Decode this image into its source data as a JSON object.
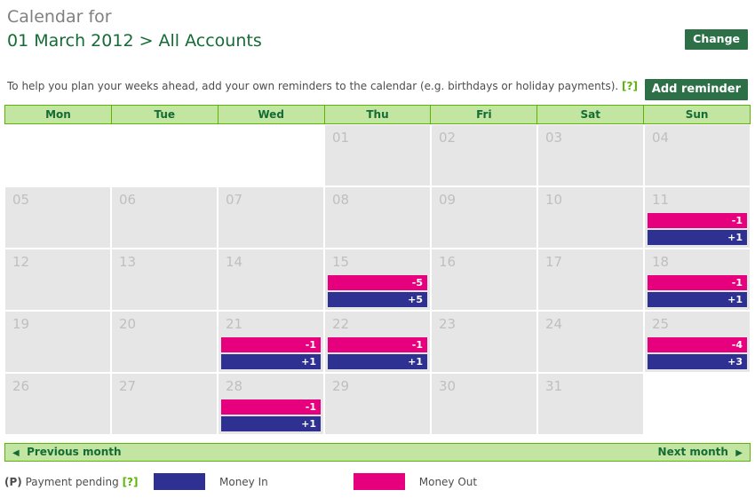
{
  "header": {
    "title_kicker": "Calendar for",
    "title_main": "01 March 2012 > All Accounts",
    "change_button": "Change",
    "add_reminder_button": "Add reminder",
    "intro_text": "To help you plan your weeks ahead, add your own reminders to the calendar (e.g. birthdays or holiday payments).",
    "intro_help": "[?]"
  },
  "calendar": {
    "day_headers": [
      "Mon",
      "Tue",
      "Wed",
      "Thu",
      "Fri",
      "Sat",
      "Sun"
    ],
    "weeks": [
      [
        {
          "day": "",
          "empty": true
        },
        {
          "day": "",
          "empty": true
        },
        {
          "day": "",
          "empty": true
        },
        {
          "day": "01"
        },
        {
          "day": "02"
        },
        {
          "day": "03"
        },
        {
          "day": "04"
        }
      ],
      [
        {
          "day": "05"
        },
        {
          "day": "06"
        },
        {
          "day": "07"
        },
        {
          "day": "08"
        },
        {
          "day": "09"
        },
        {
          "day": "10"
        },
        {
          "day": "11",
          "money_out": "-1",
          "money_in": "+1"
        }
      ],
      [
        {
          "day": "12"
        },
        {
          "day": "13"
        },
        {
          "day": "14"
        },
        {
          "day": "15",
          "money_out": "-5",
          "money_in": "+5"
        },
        {
          "day": "16"
        },
        {
          "day": "17"
        },
        {
          "day": "18",
          "money_out": "-1",
          "money_in": "+1"
        }
      ],
      [
        {
          "day": "19"
        },
        {
          "day": "20"
        },
        {
          "day": "21",
          "money_out": "-1",
          "money_in": "+1"
        },
        {
          "day": "22",
          "money_out": "-1",
          "money_in": "+1"
        },
        {
          "day": "23"
        },
        {
          "day": "24"
        },
        {
          "day": "25",
          "money_out": "-4",
          "money_in": "+3"
        }
      ],
      [
        {
          "day": "26"
        },
        {
          "day": "27"
        },
        {
          "day": "28",
          "money_out": "-1",
          "money_in": "+1"
        },
        {
          "day": "29"
        },
        {
          "day": "30"
        },
        {
          "day": "31"
        },
        {
          "day": "",
          "empty": true
        }
      ]
    ]
  },
  "nav": {
    "previous_label": "Previous month",
    "previous_arrow": "◀",
    "next_label": "Next month",
    "next_arrow": "▶"
  },
  "legend": {
    "pending_marker": "(P)",
    "pending_label": "Payment pending",
    "pending_help": "[?]",
    "money_in_label": "Money In",
    "money_out_label": "Money Out"
  },
  "colors": {
    "money_in": "#2e3192",
    "money_out": "#e6007e",
    "brand_green": "#156b35",
    "accent_green": "#5cb408",
    "header_green": "#c3e5a2",
    "button_green": "#2d7048",
    "cell_gray": "#e6e6e6"
  }
}
